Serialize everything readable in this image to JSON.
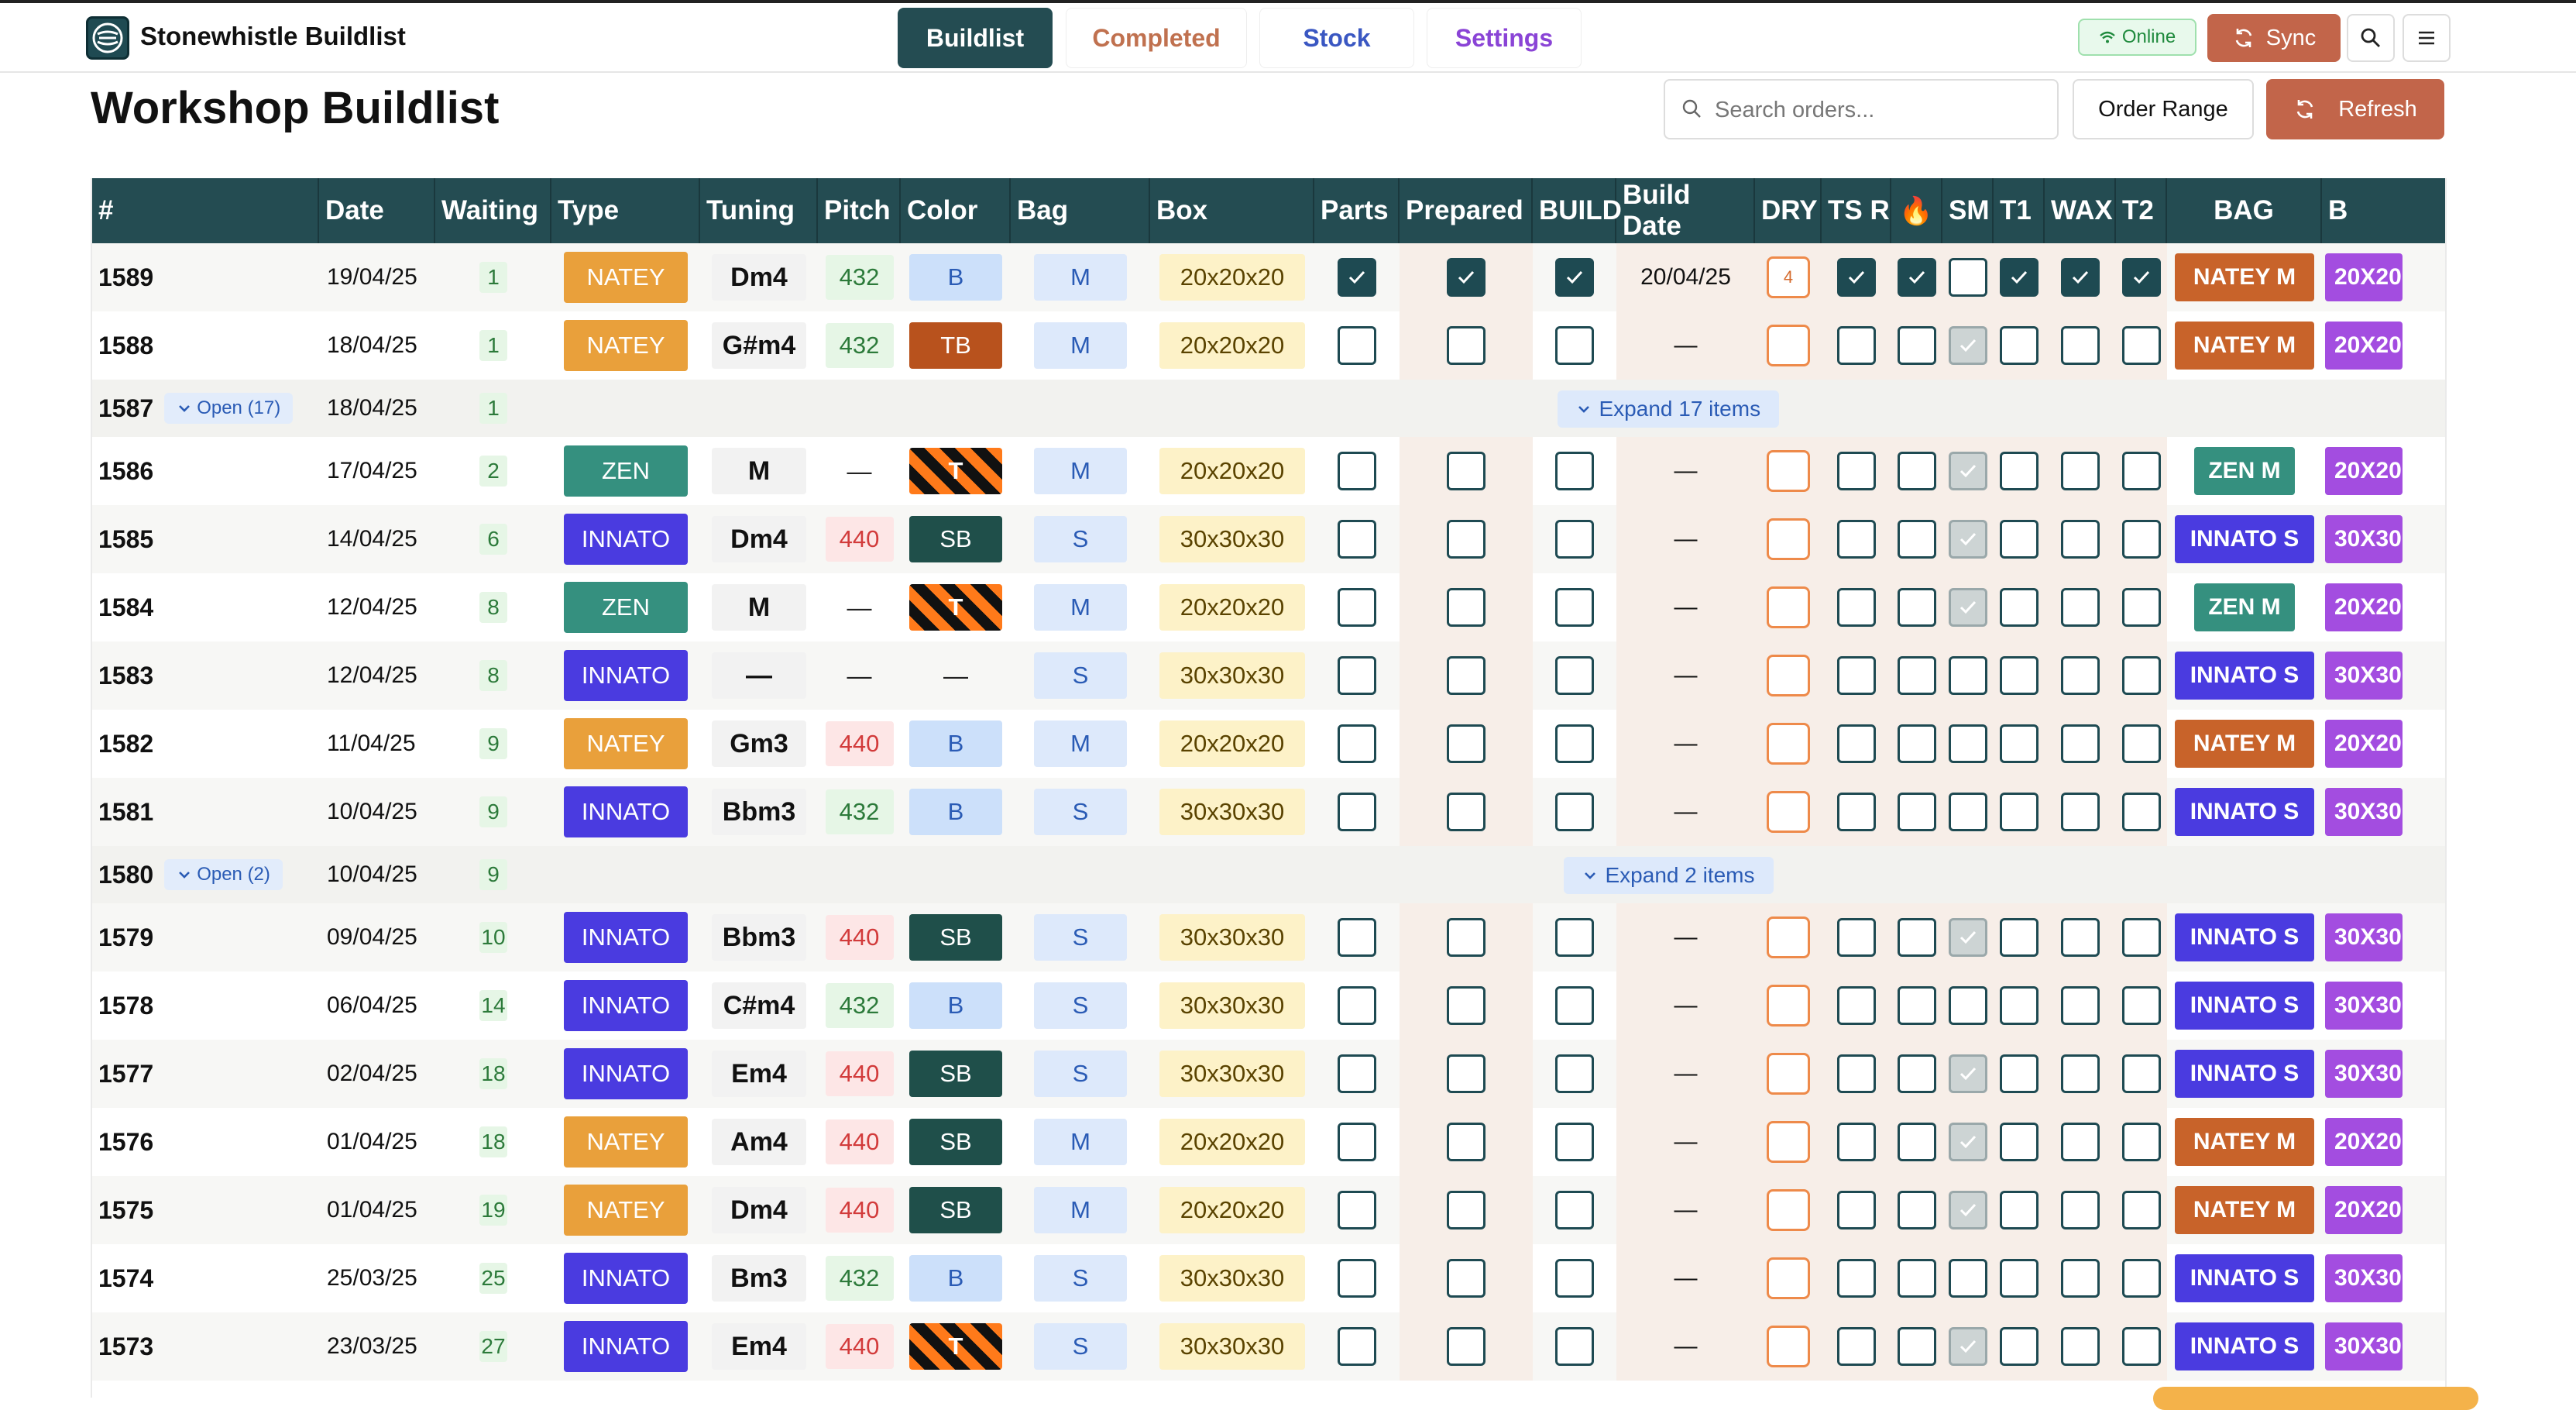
{
  "app": {
    "name": "Stonewhistle Buildlist"
  },
  "nav": {
    "tabs": [
      "Buildlist",
      "Completed",
      "Stock",
      "Settings"
    ]
  },
  "status": {
    "online": "Online",
    "sync": "Sync"
  },
  "page": {
    "title": "Workshop Buildlist",
    "search_placeholder": "Search orders...",
    "order_range": "Order Range",
    "refresh": "Refresh"
  },
  "colors": {
    "header": "#244c52",
    "accent": "#c2654a",
    "natey": "#e9a03b",
    "innato": "#4a3be0",
    "zen": "#35907f"
  },
  "table": {
    "headers": [
      "#",
      "Date",
      "Waiting",
      "Type",
      "Tuning",
      "Pitch",
      "Color",
      "Bag",
      "Box",
      "Parts",
      "Prepared",
      "BUILD",
      "Build Date",
      "DRY",
      "TS R",
      "🔥",
      "SM",
      "T1",
      "WAX",
      "T2",
      "BAG",
      "B"
    ],
    "rows": [
      {
        "kind": "row",
        "num": "1589",
        "date": "19/04/25",
        "wait": "1",
        "type": "NATEY",
        "tuning": "Dm4",
        "pitch": "432",
        "color": "B",
        "bag": "M",
        "box": "20x20x20",
        "parts": true,
        "prep": true,
        "build": true,
        "build_date": "20/04/25",
        "dry": "4",
        "tsr": true,
        "fire": true,
        "sm": false,
        "smd": false,
        "t1": true,
        "wax": true,
        "t2": true,
        "bagtag": "NATEY M",
        "boxtag": "20X20"
      },
      {
        "kind": "row",
        "num": "1588",
        "date": "18/04/25",
        "wait": "1",
        "type": "NATEY",
        "tuning": "G#m4",
        "pitch": "432",
        "color": "TB",
        "bag": "M",
        "box": "20x20x20",
        "parts": false,
        "prep": false,
        "build": false,
        "build_date": "—",
        "dry": "",
        "tsr": false,
        "fire": false,
        "sm": true,
        "smd": true,
        "t1": false,
        "wax": false,
        "t2": false,
        "bagtag": "NATEY M",
        "boxtag": "20X20"
      },
      {
        "kind": "group",
        "num": "1587",
        "open": "Open (17)",
        "date": "18/04/25",
        "wait": "1",
        "expand": "Expand 17 items"
      },
      {
        "kind": "row",
        "num": "1586",
        "date": "17/04/25",
        "wait": "2",
        "type": "ZEN",
        "tuning": "M",
        "pitch": "—",
        "color": "T",
        "bag": "M",
        "box": "20x20x20",
        "parts": false,
        "prep": false,
        "build": false,
        "build_date": "—",
        "dry": "",
        "tsr": false,
        "fire": false,
        "sm": true,
        "smd": true,
        "t1": false,
        "wax": false,
        "t2": false,
        "bagtag": "ZEN M",
        "boxtag": "20X20"
      },
      {
        "kind": "row",
        "num": "1585",
        "date": "14/04/25",
        "wait": "6",
        "type": "INNATO",
        "tuning": "Dm4",
        "pitch": "440",
        "color": "SB",
        "bag": "S",
        "box": "30x30x30",
        "parts": false,
        "prep": false,
        "build": false,
        "build_date": "—",
        "dry": "",
        "tsr": false,
        "fire": false,
        "sm": true,
        "smd": true,
        "t1": false,
        "wax": false,
        "t2": false,
        "bagtag": "INNATO S",
        "boxtag": "30X30"
      },
      {
        "kind": "row",
        "num": "1584",
        "date": "12/04/25",
        "wait": "8",
        "type": "ZEN",
        "tuning": "M",
        "pitch": "—",
        "color": "T",
        "bag": "M",
        "box": "20x20x20",
        "parts": false,
        "prep": false,
        "build": false,
        "build_date": "—",
        "dry": "",
        "tsr": false,
        "fire": false,
        "sm": true,
        "smd": true,
        "t1": false,
        "wax": false,
        "t2": false,
        "bagtag": "ZEN M",
        "boxtag": "20X20"
      },
      {
        "kind": "row",
        "num": "1583",
        "date": "12/04/25",
        "wait": "8",
        "type": "INNATO",
        "tuning": "—",
        "pitch": "—",
        "color": "—",
        "bag": "S",
        "box": "30x30x30",
        "parts": false,
        "prep": false,
        "build": false,
        "build_date": "—",
        "dry": "",
        "tsr": false,
        "fire": false,
        "sm": false,
        "smd": false,
        "t1": false,
        "wax": false,
        "t2": false,
        "bagtag": "INNATO S",
        "boxtag": "30X30"
      },
      {
        "kind": "row",
        "num": "1582",
        "date": "11/04/25",
        "wait": "9",
        "type": "NATEY",
        "tuning": "Gm3",
        "pitch": "440",
        "color": "B",
        "bag": "M",
        "box": "20x20x20",
        "parts": false,
        "prep": false,
        "build": false,
        "build_date": "—",
        "dry": "",
        "tsr": false,
        "fire": false,
        "sm": false,
        "smd": false,
        "t1": false,
        "wax": false,
        "t2": false,
        "bagtag": "NATEY M",
        "boxtag": "20X20"
      },
      {
        "kind": "row",
        "num": "1581",
        "date": "10/04/25",
        "wait": "9",
        "type": "INNATO",
        "tuning": "Bbm3",
        "pitch": "432",
        "color": "B",
        "bag": "S",
        "box": "30x30x30",
        "parts": false,
        "prep": false,
        "build": false,
        "build_date": "—",
        "dry": "",
        "tsr": false,
        "fire": false,
        "sm": false,
        "smd": false,
        "t1": false,
        "wax": false,
        "t2": false,
        "bagtag": "INNATO S",
        "boxtag": "30X30"
      },
      {
        "kind": "group",
        "num": "1580",
        "open": "Open (2)",
        "date": "10/04/25",
        "wait": "9",
        "expand": "Expand 2 items"
      },
      {
        "kind": "row",
        "num": "1579",
        "date": "09/04/25",
        "wait": "10",
        "type": "INNATO",
        "tuning": "Bbm3",
        "pitch": "440",
        "color": "SB",
        "bag": "S",
        "box": "30x30x30",
        "parts": false,
        "prep": false,
        "build": false,
        "build_date": "—",
        "dry": "",
        "tsr": false,
        "fire": false,
        "sm": true,
        "smd": true,
        "t1": false,
        "wax": false,
        "t2": false,
        "bagtag": "INNATO S",
        "boxtag": "30X30"
      },
      {
        "kind": "row",
        "num": "1578",
        "date": "06/04/25",
        "wait": "14",
        "type": "INNATO",
        "tuning": "C#m4",
        "pitch": "432",
        "color": "B",
        "bag": "S",
        "box": "30x30x30",
        "parts": false,
        "prep": false,
        "build": false,
        "build_date": "—",
        "dry": "",
        "tsr": false,
        "fire": false,
        "sm": false,
        "smd": false,
        "t1": false,
        "wax": false,
        "t2": false,
        "bagtag": "INNATO S",
        "boxtag": "30X30"
      },
      {
        "kind": "row",
        "num": "1577",
        "date": "02/04/25",
        "wait": "18",
        "type": "INNATO",
        "tuning": "Em4",
        "pitch": "440",
        "color": "SB",
        "bag": "S",
        "box": "30x30x30",
        "parts": false,
        "prep": false,
        "build": false,
        "build_date": "—",
        "dry": "",
        "tsr": false,
        "fire": false,
        "sm": true,
        "smd": true,
        "t1": false,
        "wax": false,
        "t2": false,
        "bagtag": "INNATO S",
        "boxtag": "30X30"
      },
      {
        "kind": "row",
        "num": "1576",
        "date": "01/04/25",
        "wait": "18",
        "type": "NATEY",
        "tuning": "Am4",
        "pitch": "440",
        "color": "SB",
        "bag": "M",
        "box": "20x20x20",
        "parts": false,
        "prep": false,
        "build": false,
        "build_date": "—",
        "dry": "",
        "tsr": false,
        "fire": false,
        "sm": true,
        "smd": true,
        "t1": false,
        "wax": false,
        "t2": false,
        "bagtag": "NATEY M",
        "boxtag": "20X20"
      },
      {
        "kind": "row",
        "num": "1575",
        "date": "01/04/25",
        "wait": "19",
        "type": "NATEY",
        "tuning": "Dm4",
        "pitch": "440",
        "color": "SB",
        "bag": "M",
        "box": "20x20x20",
        "parts": false,
        "prep": false,
        "build": false,
        "build_date": "—",
        "dry": "",
        "tsr": false,
        "fire": false,
        "sm": true,
        "smd": true,
        "t1": false,
        "wax": false,
        "t2": false,
        "bagtag": "NATEY M",
        "boxtag": "20X20"
      },
      {
        "kind": "row",
        "num": "1574",
        "date": "25/03/25",
        "wait": "25",
        "type": "INNATO",
        "tuning": "Bm3",
        "pitch": "432",
        "color": "B",
        "bag": "S",
        "box": "30x30x30",
        "parts": false,
        "prep": false,
        "build": false,
        "build_date": "—",
        "dry": "",
        "tsr": false,
        "fire": false,
        "sm": false,
        "smd": false,
        "t1": false,
        "wax": false,
        "t2": false,
        "bagtag": "INNATO S",
        "boxtag": "30X30"
      },
      {
        "kind": "row",
        "num": "1573",
        "date": "23/03/25",
        "wait": "27",
        "type": "INNATO",
        "tuning": "Em4",
        "pitch": "440",
        "color": "T",
        "bag": "S",
        "box": "30x30x30",
        "parts": false,
        "prep": false,
        "build": false,
        "build_date": "—",
        "dry": "",
        "tsr": false,
        "fire": false,
        "sm": true,
        "smd": true,
        "t1": false,
        "wax": false,
        "t2": false,
        "bagtag": "INNATO S",
        "boxtag": "30X30"
      }
    ]
  }
}
